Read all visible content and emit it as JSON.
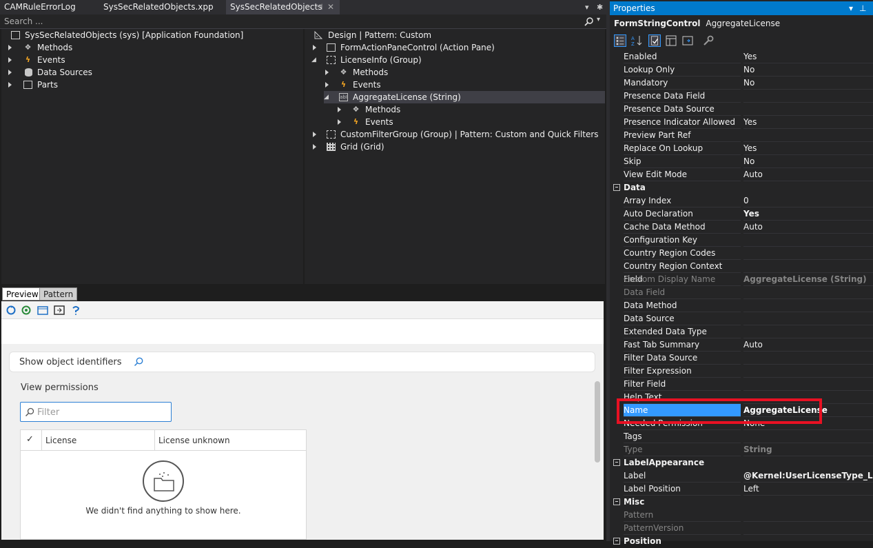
{
  "tabs": [
    {
      "label": "CAMRuleErrorLog"
    },
    {
      "label": "SysSecRelatedObjects.xpp"
    },
    {
      "label": "SysSecRelatedObjects"
    }
  ],
  "tab_pin": "⊣",
  "tab_close": "✕",
  "tab_dropdown": "▾",
  "tab_settings": "✱",
  "search": {
    "placeholder": "Search ...",
    "icon": "search-icon"
  },
  "left_tree": {
    "root": "SysSecRelatedObjects (sys) [Application Foundation]",
    "items": [
      "Methods",
      "Events",
      "Data Sources",
      "Parts"
    ]
  },
  "design_tree": {
    "root": "Design | Pattern: Custom",
    "items": [
      "FormActionPaneControl (Action Pane)",
      "LicenseInfo (Group)",
      "Methods",
      "Events",
      "AggregateLicense (String)",
      "Methods",
      "Events",
      "CustomFilterGroup (Group) | Pattern: Custom and Quick Filters",
      "Grid (Grid)"
    ]
  },
  "preview": {
    "tabs": [
      "Preview",
      "Pattern"
    ],
    "show_ids": "Show object identifiers",
    "view_permissions": "View permissions",
    "filter_placeholder": "Filter",
    "grid_headers": [
      "License",
      "License unknown"
    ],
    "empty_text": "We didn't find anything to show here."
  },
  "properties": {
    "title": "Properties",
    "object_type": "FormStringControl",
    "object_name": "AggregateLicense",
    "rows": [
      {
        "name": "Enabled",
        "value": "Yes"
      },
      {
        "name": "Lookup Only",
        "value": "No"
      },
      {
        "name": "Mandatory",
        "value": "No"
      },
      {
        "name": "Presence Data Field",
        "value": ""
      },
      {
        "name": "Presence Data Source",
        "value": ""
      },
      {
        "name": "Presence Indicator Allowed",
        "value": "Yes"
      },
      {
        "name": "Preview Part Ref",
        "value": ""
      },
      {
        "name": "Replace On Lookup",
        "value": "Yes"
      },
      {
        "name": "Skip",
        "value": "No"
      },
      {
        "name": "View Edit Mode",
        "value": "Auto"
      }
    ],
    "cat_data": "Data",
    "data_rows": [
      {
        "name": "Array Index",
        "value": "0"
      },
      {
        "name": "Auto Declaration",
        "value": "Yes"
      },
      {
        "name": "Cache Data Method",
        "value": "Auto"
      },
      {
        "name": "Configuration Key",
        "value": ""
      },
      {
        "name": "Country Region Codes",
        "value": ""
      },
      {
        "name": "Country Region Context Field",
        "value": ""
      },
      {
        "name": "Custom Display Name",
        "value": "AggregateLicense (String)"
      },
      {
        "name": "Data Field",
        "value": ""
      },
      {
        "name": "Data Method",
        "value": ""
      },
      {
        "name": "Data Source",
        "value": ""
      },
      {
        "name": "Extended Data Type",
        "value": ""
      },
      {
        "name": "Fast Tab Summary",
        "value": "Auto"
      },
      {
        "name": "Filter Data Source",
        "value": ""
      },
      {
        "name": "Filter Expression",
        "value": ""
      },
      {
        "name": "Filter Field",
        "value": ""
      },
      {
        "name": "Help Text",
        "value": ""
      },
      {
        "name": "Name",
        "value": "AggregateLicense"
      },
      {
        "name": "Needed Permission",
        "value": "None"
      },
      {
        "name": "Tags",
        "value": ""
      },
      {
        "name": "Type",
        "value": "String"
      }
    ],
    "cat_label": "LabelAppearance",
    "label_rows": [
      {
        "name": "Label",
        "value": "@Kernel:UserLicenseType_Label"
      },
      {
        "name": "Label Position",
        "value": "Left"
      }
    ],
    "cat_misc": "Misc",
    "misc_rows": [
      {
        "name": "Pattern",
        "value": ""
      },
      {
        "name": "PatternVersion",
        "value": ""
      }
    ],
    "cat_position": "Position"
  },
  "colors": {
    "accent": "#007acc",
    "highlight": "#e81123",
    "selection": "#3399ff"
  }
}
